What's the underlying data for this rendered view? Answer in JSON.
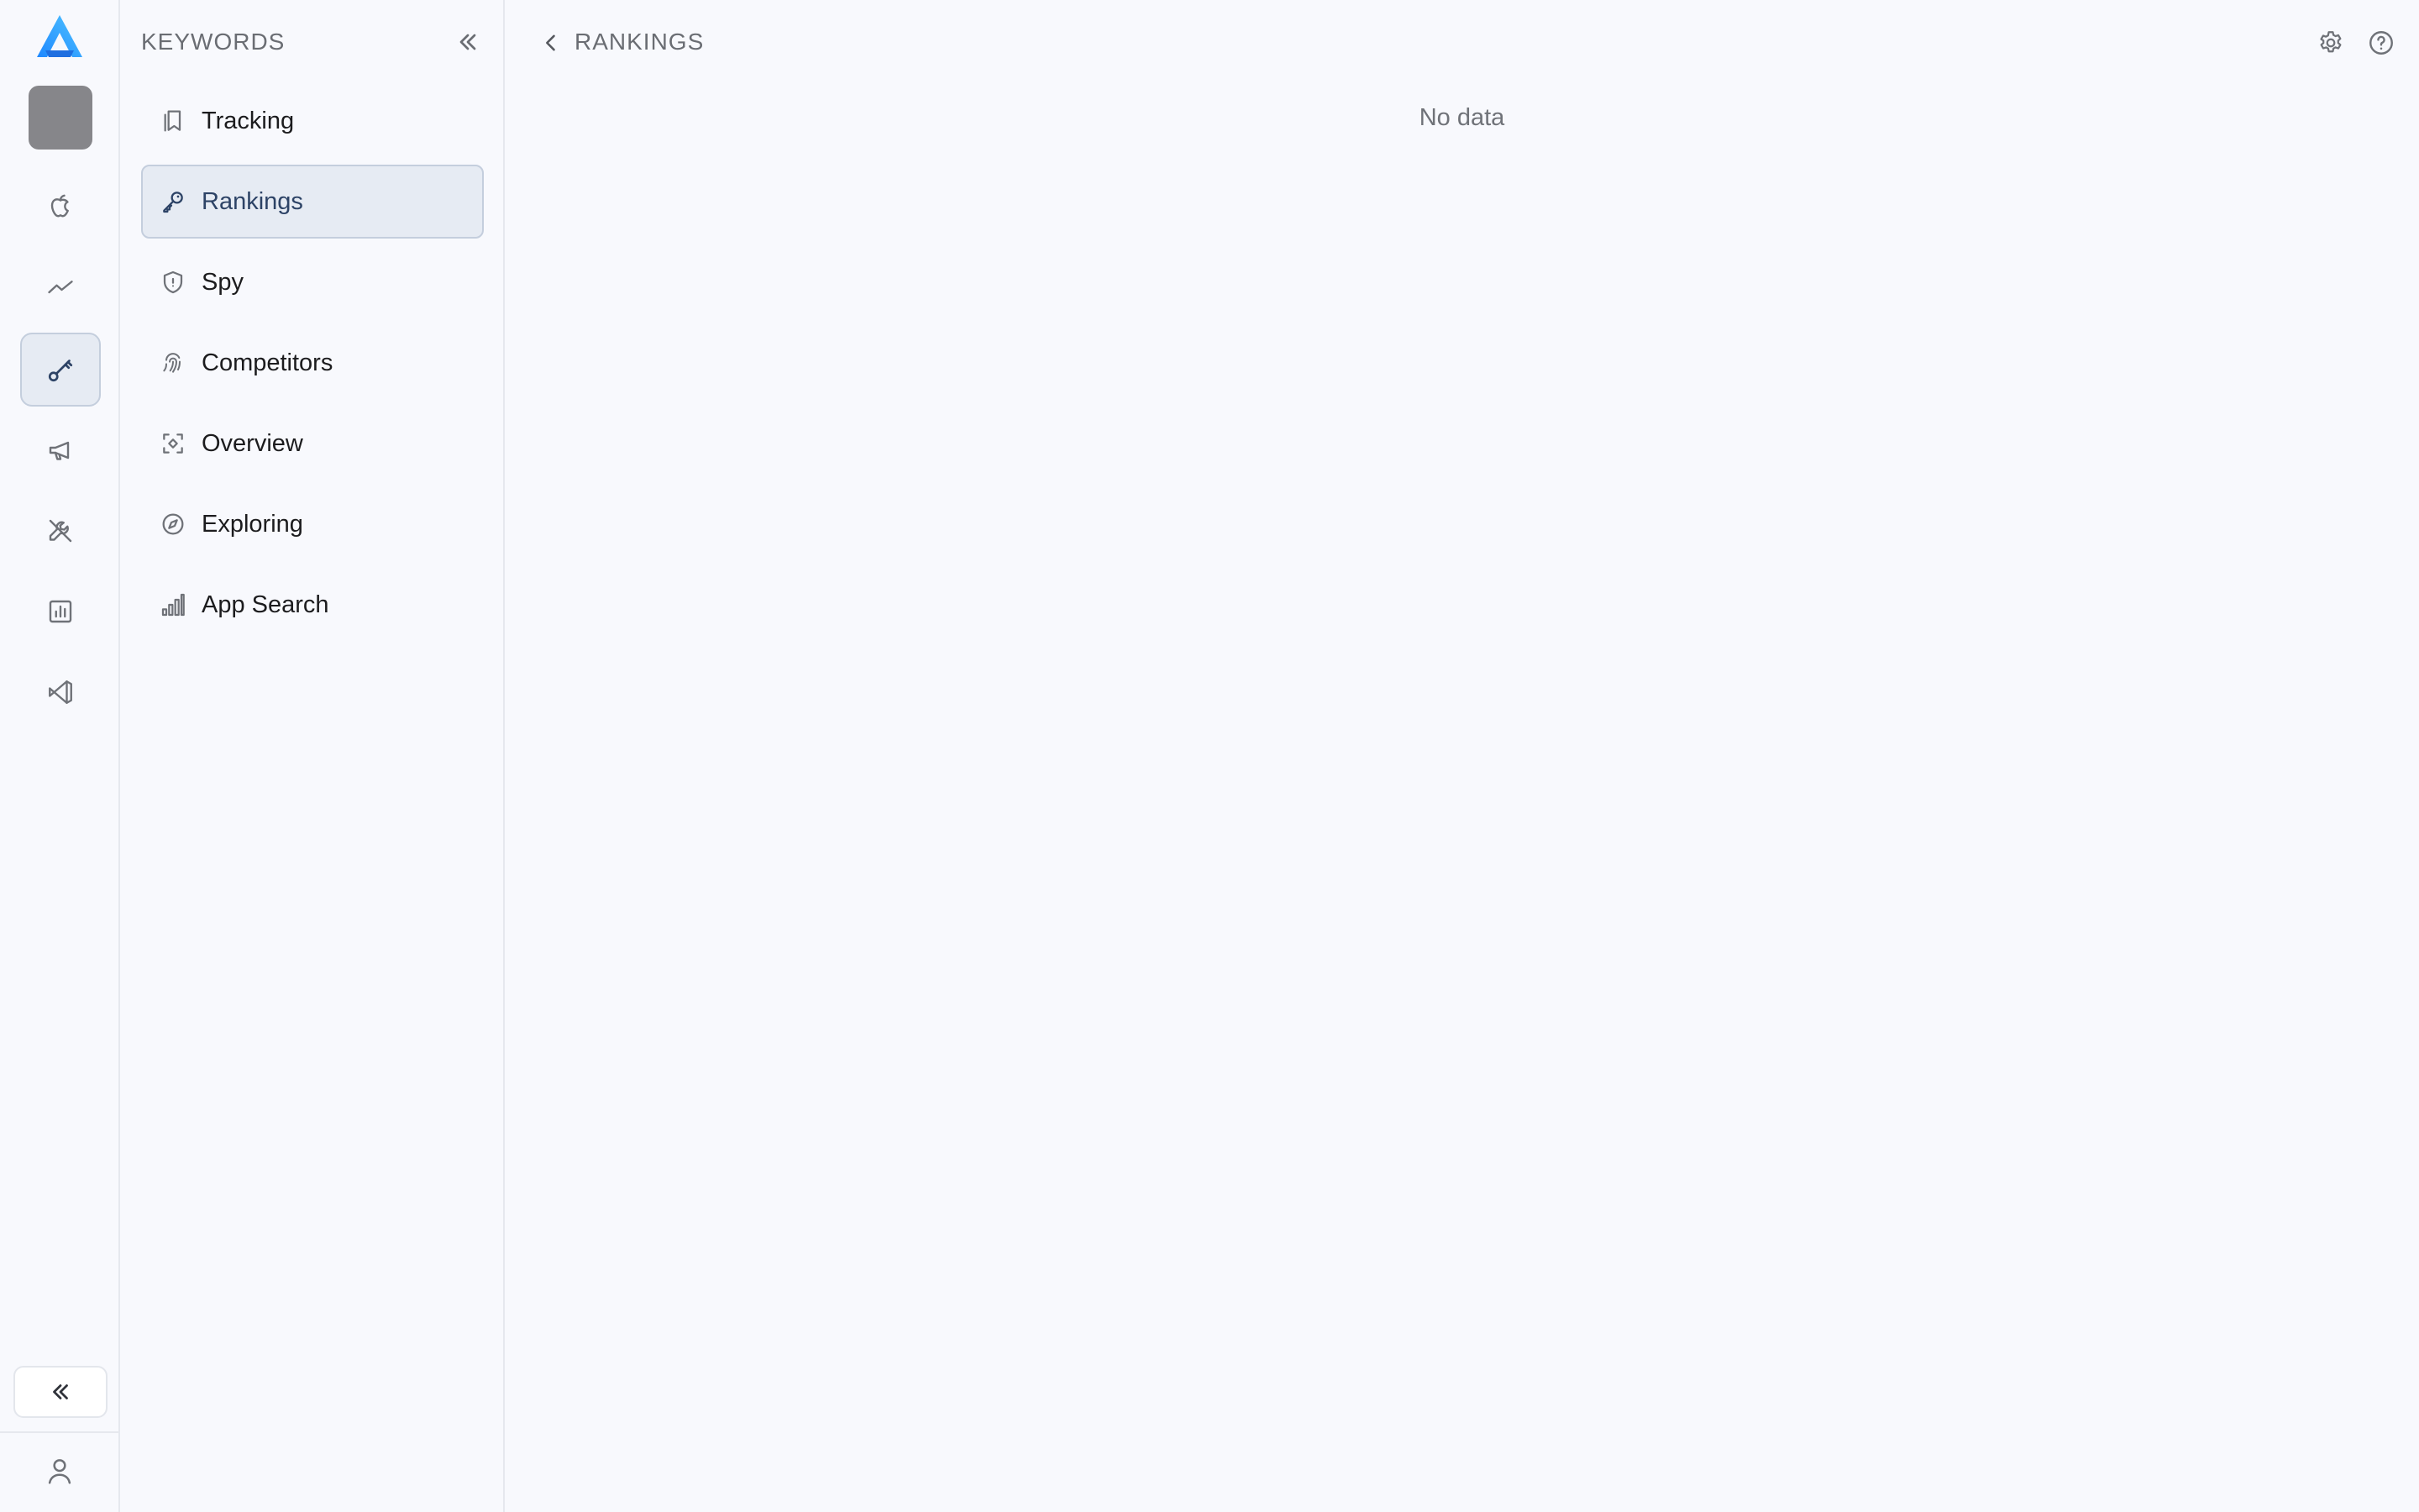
{
  "icons": {
    "logo": "app-logo-icon",
    "rail": [
      "apple-icon",
      "trend-line-icon",
      "key-icon",
      "megaphone-icon",
      "wrench-icon",
      "bar-chart-icon",
      "vs-code-icon"
    ],
    "collapse": "chevrons-left-icon",
    "user": "user-icon"
  },
  "colors": {
    "accent": "#2d4366",
    "logo_gradient": [
      "#1e88ff",
      "#4fc3ff"
    ],
    "active_background": "#e6ebf3"
  },
  "sidebar": {
    "title": "KEYWORDS",
    "items": [
      {
        "label": "Tracking",
        "icon": "bookmark-icon"
      },
      {
        "label": "Rankings",
        "icon": "key-icon",
        "active": true
      },
      {
        "label": "Spy",
        "icon": "shield-icon"
      },
      {
        "label": "Competitors",
        "icon": "fingerprint-icon"
      },
      {
        "label": "Overview",
        "icon": "focus-scan-icon"
      },
      {
        "label": "Exploring",
        "icon": "compass-icon"
      },
      {
        "label": "App Search",
        "icon": "signal-bars-icon"
      }
    ]
  },
  "header": {
    "breadcrumb": "RANKINGS"
  },
  "main": {
    "empty_text": "No data"
  }
}
